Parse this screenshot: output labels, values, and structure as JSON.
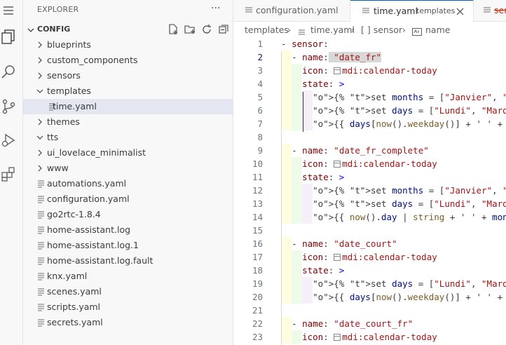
{
  "explorer": {
    "title": "EXPLORER",
    "more_label": "···",
    "section": "CONFIG",
    "items": [
      {
        "name": "blueprints",
        "type": "folder",
        "open": false,
        "depth": 0
      },
      {
        "name": "custom_components",
        "type": "folder",
        "open": false,
        "depth": 0
      },
      {
        "name": "sensors",
        "type": "folder",
        "open": false,
        "depth": 0
      },
      {
        "name": "templates",
        "type": "folder",
        "open": true,
        "depth": 0
      },
      {
        "name": "time.yaml",
        "type": "file",
        "depth": 1,
        "selected": true
      },
      {
        "name": "themes",
        "type": "folder",
        "open": false,
        "depth": 0
      },
      {
        "name": "tts",
        "type": "folder",
        "open": true,
        "depth": 0
      },
      {
        "name": "ui_lovelace_minimalist",
        "type": "folder",
        "open": false,
        "depth": 0
      },
      {
        "name": "www",
        "type": "folder",
        "open": false,
        "depth": 0
      },
      {
        "name": "automations.yaml",
        "type": "file",
        "depth": 0
      },
      {
        "name": "configuration.yaml",
        "type": "file",
        "depth": 0
      },
      {
        "name": "go2rtc-1.8.4",
        "type": "file",
        "depth": 0
      },
      {
        "name": "home-assistant.log",
        "type": "file",
        "depth": 0
      },
      {
        "name": "home-assistant.log.1",
        "type": "file",
        "depth": 0
      },
      {
        "name": "home-assistant.log.fault",
        "type": "file",
        "depth": 0
      },
      {
        "name": "knx.yaml",
        "type": "file",
        "depth": 0
      },
      {
        "name": "scenes.yaml",
        "type": "file",
        "depth": 0
      },
      {
        "name": "scripts.yaml",
        "type": "file",
        "depth": 0
      },
      {
        "name": "secrets.yaml",
        "type": "file",
        "depth": 0
      }
    ]
  },
  "tabs": [
    {
      "label": "configuration.yaml",
      "desc": ""
    },
    {
      "label": "time.yaml",
      "desc": "templates",
      "active": true
    },
    {
      "label": "sensors",
      "desc": ""
    }
  ],
  "breadcrumb": [
    "templates",
    "time.yaml",
    "[ ] sensor",
    "name"
  ],
  "editor": {
    "current_line": 2,
    "lines": [
      "- sensor:",
      "  - name: \"date_fr\"",
      "    icon: mdi:calendar-today",
      "    state: >",
      "      {% set months = [\"Janvier\", \"Fevrier\", ...",
      "      {% set days = [\"Lundi\", \"Mardi\", ...",
      "      {{ days[now().weekday()] + ' ' + months ...",
      "",
      "  - name: \"date_fr_complete\"",
      "    icon: mdi:calendar-today",
      "    state: >",
      "      {% set months = [\"Janvier\", \"Fevrier\", ...",
      "      {% set days = [\"Lundi\", \"Mardi\", ...",
      "      {{ now().day | string + ' ' + months ...",
      "",
      "  - name: \"date_court\"",
      "    icon: mdi:calendar-today",
      "    state: >",
      "      {% set days = [\"Lundi\", \"Mardi\", ...",
      "      {{ days[now().weekday()] + ' ' + ...",
      "",
      "  - name: \"date_court_fr\"",
      "    icon: mdi:calendar-today"
    ]
  },
  "colors": {
    "accent": "#005fb8",
    "selection": "#e4e6f1",
    "string": "#a31515",
    "key": "#800000",
    "keyword": "#af00db"
  }
}
